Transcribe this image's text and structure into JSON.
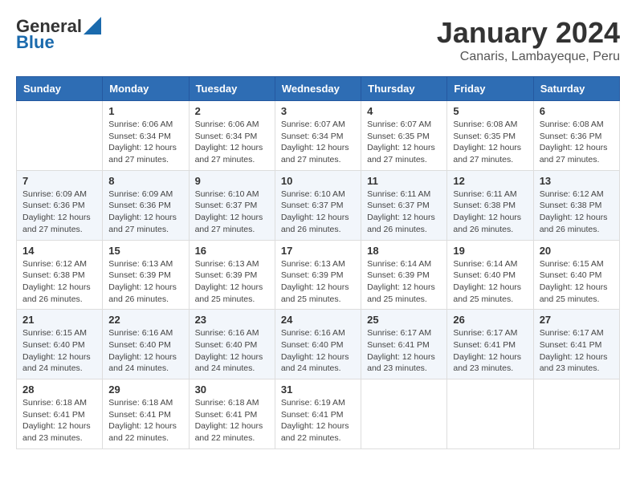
{
  "header": {
    "logo_general": "General",
    "logo_blue": "Blue",
    "main_title": "January 2024",
    "subtitle": "Canaris, Lambayeque, Peru"
  },
  "weekdays": [
    "Sunday",
    "Monday",
    "Tuesday",
    "Wednesday",
    "Thursday",
    "Friday",
    "Saturday"
  ],
  "weeks": [
    [
      {
        "day": "",
        "sunrise": "",
        "sunset": "",
        "daylight": ""
      },
      {
        "day": "1",
        "sunrise": "Sunrise: 6:06 AM",
        "sunset": "Sunset: 6:34 PM",
        "daylight": "Daylight: 12 hours and 27 minutes."
      },
      {
        "day": "2",
        "sunrise": "Sunrise: 6:06 AM",
        "sunset": "Sunset: 6:34 PM",
        "daylight": "Daylight: 12 hours and 27 minutes."
      },
      {
        "day": "3",
        "sunrise": "Sunrise: 6:07 AM",
        "sunset": "Sunset: 6:34 PM",
        "daylight": "Daylight: 12 hours and 27 minutes."
      },
      {
        "day": "4",
        "sunrise": "Sunrise: 6:07 AM",
        "sunset": "Sunset: 6:35 PM",
        "daylight": "Daylight: 12 hours and 27 minutes."
      },
      {
        "day": "5",
        "sunrise": "Sunrise: 6:08 AM",
        "sunset": "Sunset: 6:35 PM",
        "daylight": "Daylight: 12 hours and 27 minutes."
      },
      {
        "day": "6",
        "sunrise": "Sunrise: 6:08 AM",
        "sunset": "Sunset: 6:36 PM",
        "daylight": "Daylight: 12 hours and 27 minutes."
      }
    ],
    [
      {
        "day": "7",
        "sunrise": "Sunrise: 6:09 AM",
        "sunset": "Sunset: 6:36 PM",
        "daylight": "Daylight: 12 hours and 27 minutes."
      },
      {
        "day": "8",
        "sunrise": "Sunrise: 6:09 AM",
        "sunset": "Sunset: 6:36 PM",
        "daylight": "Daylight: 12 hours and 27 minutes."
      },
      {
        "day": "9",
        "sunrise": "Sunrise: 6:10 AM",
        "sunset": "Sunset: 6:37 PM",
        "daylight": "Daylight: 12 hours and 27 minutes."
      },
      {
        "day": "10",
        "sunrise": "Sunrise: 6:10 AM",
        "sunset": "Sunset: 6:37 PM",
        "daylight": "Daylight: 12 hours and 26 minutes."
      },
      {
        "day": "11",
        "sunrise": "Sunrise: 6:11 AM",
        "sunset": "Sunset: 6:37 PM",
        "daylight": "Daylight: 12 hours and 26 minutes."
      },
      {
        "day": "12",
        "sunrise": "Sunrise: 6:11 AM",
        "sunset": "Sunset: 6:38 PM",
        "daylight": "Daylight: 12 hours and 26 minutes."
      },
      {
        "day": "13",
        "sunrise": "Sunrise: 6:12 AM",
        "sunset": "Sunset: 6:38 PM",
        "daylight": "Daylight: 12 hours and 26 minutes."
      }
    ],
    [
      {
        "day": "14",
        "sunrise": "Sunrise: 6:12 AM",
        "sunset": "Sunset: 6:38 PM",
        "daylight": "Daylight: 12 hours and 26 minutes."
      },
      {
        "day": "15",
        "sunrise": "Sunrise: 6:13 AM",
        "sunset": "Sunset: 6:39 PM",
        "daylight": "Daylight: 12 hours and 26 minutes."
      },
      {
        "day": "16",
        "sunrise": "Sunrise: 6:13 AM",
        "sunset": "Sunset: 6:39 PM",
        "daylight": "Daylight: 12 hours and 25 minutes."
      },
      {
        "day": "17",
        "sunrise": "Sunrise: 6:13 AM",
        "sunset": "Sunset: 6:39 PM",
        "daylight": "Daylight: 12 hours and 25 minutes."
      },
      {
        "day": "18",
        "sunrise": "Sunrise: 6:14 AM",
        "sunset": "Sunset: 6:39 PM",
        "daylight": "Daylight: 12 hours and 25 minutes."
      },
      {
        "day": "19",
        "sunrise": "Sunrise: 6:14 AM",
        "sunset": "Sunset: 6:40 PM",
        "daylight": "Daylight: 12 hours and 25 minutes."
      },
      {
        "day": "20",
        "sunrise": "Sunrise: 6:15 AM",
        "sunset": "Sunset: 6:40 PM",
        "daylight": "Daylight: 12 hours and 25 minutes."
      }
    ],
    [
      {
        "day": "21",
        "sunrise": "Sunrise: 6:15 AM",
        "sunset": "Sunset: 6:40 PM",
        "daylight": "Daylight: 12 hours and 24 minutes."
      },
      {
        "day": "22",
        "sunrise": "Sunrise: 6:16 AM",
        "sunset": "Sunset: 6:40 PM",
        "daylight": "Daylight: 12 hours and 24 minutes."
      },
      {
        "day": "23",
        "sunrise": "Sunrise: 6:16 AM",
        "sunset": "Sunset: 6:40 PM",
        "daylight": "Daylight: 12 hours and 24 minutes."
      },
      {
        "day": "24",
        "sunrise": "Sunrise: 6:16 AM",
        "sunset": "Sunset: 6:40 PM",
        "daylight": "Daylight: 12 hours and 24 minutes."
      },
      {
        "day": "25",
        "sunrise": "Sunrise: 6:17 AM",
        "sunset": "Sunset: 6:41 PM",
        "daylight": "Daylight: 12 hours and 23 minutes."
      },
      {
        "day": "26",
        "sunrise": "Sunrise: 6:17 AM",
        "sunset": "Sunset: 6:41 PM",
        "daylight": "Daylight: 12 hours and 23 minutes."
      },
      {
        "day": "27",
        "sunrise": "Sunrise: 6:17 AM",
        "sunset": "Sunset: 6:41 PM",
        "daylight": "Daylight: 12 hours and 23 minutes."
      }
    ],
    [
      {
        "day": "28",
        "sunrise": "Sunrise: 6:18 AM",
        "sunset": "Sunset: 6:41 PM",
        "daylight": "Daylight: 12 hours and 23 minutes."
      },
      {
        "day": "29",
        "sunrise": "Sunrise: 6:18 AM",
        "sunset": "Sunset: 6:41 PM",
        "daylight": "Daylight: 12 hours and 22 minutes."
      },
      {
        "day": "30",
        "sunrise": "Sunrise: 6:18 AM",
        "sunset": "Sunset: 6:41 PM",
        "daylight": "Daylight: 12 hours and 22 minutes."
      },
      {
        "day": "31",
        "sunrise": "Sunrise: 6:19 AM",
        "sunset": "Sunset: 6:41 PM",
        "daylight": "Daylight: 12 hours and 22 minutes."
      },
      {
        "day": "",
        "sunrise": "",
        "sunset": "",
        "daylight": ""
      },
      {
        "day": "",
        "sunrise": "",
        "sunset": "",
        "daylight": ""
      },
      {
        "day": "",
        "sunrise": "",
        "sunset": "",
        "daylight": ""
      }
    ]
  ]
}
